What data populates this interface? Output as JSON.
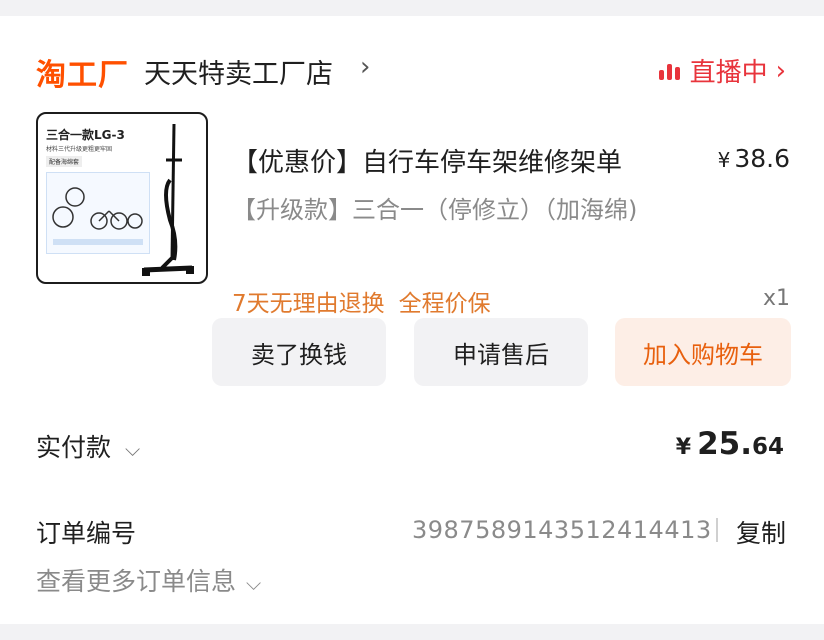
{
  "shop": {
    "logo": "淘工厂",
    "name": "天天特卖工厂店",
    "chevron": "›",
    "live_label": "直播中",
    "live_chevron": "›",
    "live_color": "#e8343c"
  },
  "product": {
    "image": {
      "title": "三合一款LG-3",
      "subtitle": "材料三代升级更粗更牢固",
      "tag": "配备海绵套"
    },
    "title": "【优惠价】自行车停车架维修架单",
    "price_currency": "¥",
    "price": "38.6",
    "spec": "【升级款】三合一（停修立）（加海绵)",
    "tag_return": "7天无理由退换",
    "tag_price": "全程价保",
    "quantity": "x1"
  },
  "actions": {
    "sell_label": "卖了换钱",
    "after_sale_label": "申请售后",
    "cart_label": "加入购物车",
    "accent_color": "#e8600e"
  },
  "summary": {
    "paid_label": "实付款",
    "paid_chevron": "⌵",
    "paid_currency": "¥",
    "paid_integer": "25.",
    "paid_decimal": "64",
    "order_label": "订单编号",
    "order_number": "3987589143512414413",
    "copy_label": "复制",
    "more_label": "查看更多订单信息",
    "more_chevron": "⌵"
  }
}
